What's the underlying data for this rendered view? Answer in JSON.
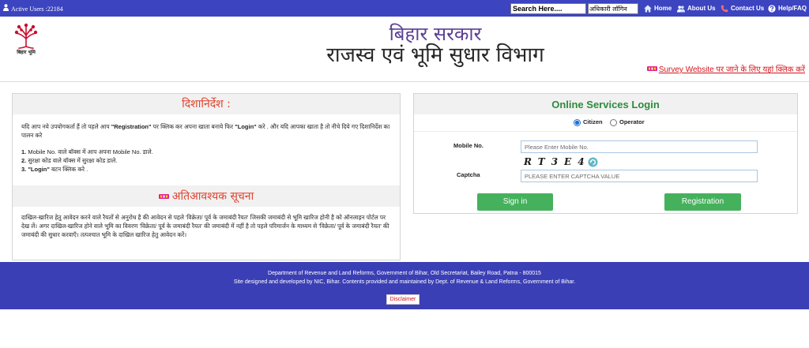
{
  "colors": {
    "bar_blue": "#3c44c0",
    "footer_blue": "#3b3fb5",
    "heading_red": "#e0412c",
    "login_green": "#2e8b3e",
    "button_green": "#45b15d",
    "link_red": "#d4141c",
    "title_purple": "#5b3f93",
    "logo_red": "#c8102e"
  },
  "topbar": {
    "active_users": "Active Users :22184",
    "user_icon": "user-icon",
    "search_placeholder": "Search Here....",
    "login_select": "अधिकारी लॉगिन",
    "nav": [
      {
        "label": "Home",
        "icon": "home-icon"
      },
      {
        "label": "About Us",
        "icon": "about-icon"
      },
      {
        "label": "Contact Us",
        "icon": "phone-icon"
      },
      {
        "label": "Help/FAQ",
        "icon": "help-icon"
      }
    ]
  },
  "header": {
    "logo_caption": "बिहार भूमि",
    "title_line1": "बिहार सरकार",
    "title_line2": "राजस्व एवं भूमि सुधार विभाग",
    "survey_icon": "new-badge-icon",
    "survey_link": "Survey Website पर जाने के लिए यहां क्लिक करें"
  },
  "guidelines": {
    "heading": "दिशानिर्देश :",
    "intro": [
      "यदि आप नये उपयोगकर्ता हैं तो पहले आप ",
      "\"Registration\"",
      " पर क्लिक कर अपना खाता बनाये फिर ",
      "\"Login\"",
      " करे . और यदि आपका खाता है तो नीचे दिये गए दिशानिर्देश का पालन करे"
    ],
    "steps": [
      {
        "num": "1.",
        "bold": "",
        "text": " Mobile No. वाले बॉक्स में आप अपना Mobile No. डाले."
      },
      {
        "num": "2.",
        "bold": "",
        "text": " सुरक्षा कोड वाले बॉक्स में सुरक्षा कोड डाले."
      },
      {
        "num": "3.",
        "bold": " \"Login\"",
        "text": " बटन क्लिक करे ."
      }
    ]
  },
  "notice": {
    "icon": "new-badge-icon",
    "heading": "अतिआवश्यक सूचना",
    "text": "दाखिल-खारिज हेतु आवेदन करने वाले रैयतों से अनुरोध है की आवेदन से पहले 'विक्रेता/ पूर्व के जमाबंदी रैयत' जिसकी जमाबंदी से भूमि खारिज होनी है को ऑनलाइन पोर्टल पर देख लें। अगर दाखिल-खारिज होने वाले भूमि का विवरण 'विक्रेता/ पूर्व के जमाबंदी रैयत' की जमाबंदी में नहीं है तो पहले परिमार्जन के माध्यम से 'विक्रेता/ पूर्व के जमाबंदी रैयत' की जमाबंदी की सुधार करवाएँ। तत्पश्चात भूमि के दाखिल खारिज हेतु आवेदन करें।"
  },
  "login": {
    "heading": "Online Services Login",
    "roles": [
      {
        "label": "Citizen",
        "selected": true
      },
      {
        "label": "Operator",
        "selected": false
      }
    ],
    "mobile_label": "Mobile No.",
    "mobile_placeholder": "Please Enter Mobile No.",
    "captcha_code": "RT3E4",
    "captcha_refresh_icon": "refresh-icon",
    "captcha_label": "Captcha",
    "captcha_placeholder": "PLEASE ENTER CAPTCHA VALUE",
    "signin_label": "Sign in",
    "registration_label": "Registration"
  },
  "footer": {
    "address": "Department of Revenue and Land Reforms, Government of Bihar, Old Secretariat, Bailey Road, Patna - 800015",
    "credits": "Site designed and developed by NIC, Bihar. Contents provided and maintained by Dept. of Revenue & Land Reforms, Government of Bihar.",
    "disclaimer": "Disclaimer"
  }
}
